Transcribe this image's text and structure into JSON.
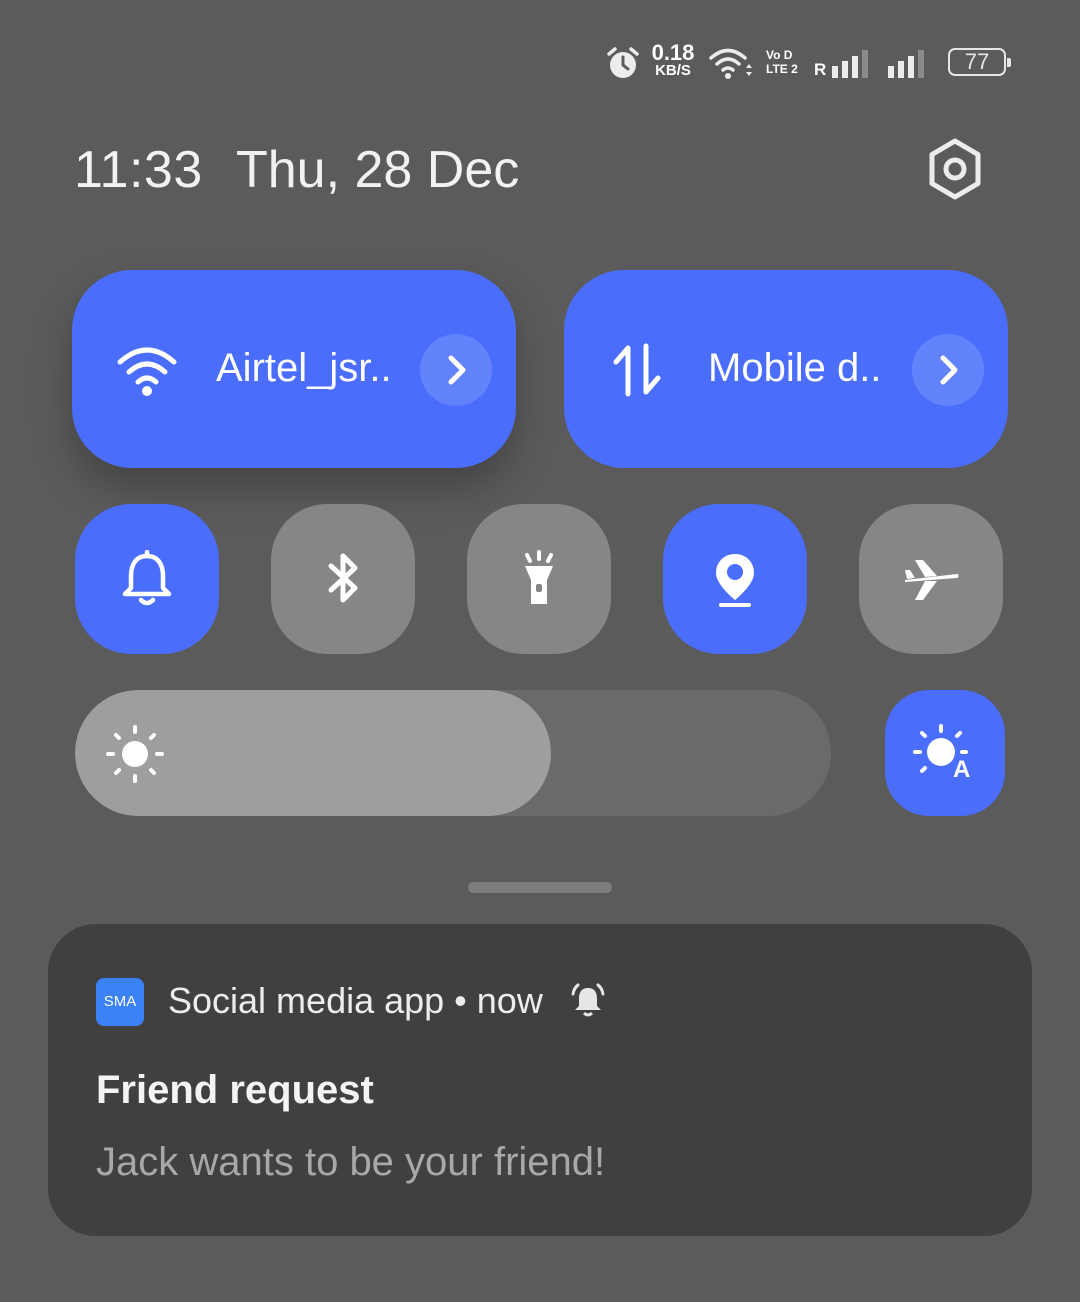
{
  "status_bar": {
    "net_speed_value": "0.18",
    "net_speed_unit": "KB/S",
    "volte_top": "Vo D",
    "volte_bottom": "LTE 2",
    "roaming": "R",
    "battery": "77",
    "icons": [
      "alarm-icon",
      "wifi-icon",
      "signal-icon",
      "signal-icon"
    ]
  },
  "header": {
    "time": "11:33",
    "date": "Thu, 28 Dec",
    "settings_icon": "gear-icon"
  },
  "tiles": {
    "wifi": {
      "label": "Airtel_jsr..",
      "icon": "wifi-icon",
      "active": true
    },
    "mobile_data": {
      "label": "Mobile d..",
      "icon": "data-arrows-icon",
      "active": true
    },
    "quick": [
      {
        "name": "sound",
        "icon": "bell-icon",
        "active": true
      },
      {
        "name": "bluetooth",
        "icon": "bluetooth-icon",
        "active": false
      },
      {
        "name": "flashlight",
        "icon": "flashlight-icon",
        "active": false
      },
      {
        "name": "location",
        "icon": "location-pin-icon",
        "active": true
      },
      {
        "name": "airplane",
        "icon": "airplane-icon",
        "active": false
      }
    ]
  },
  "brightness": {
    "level_fraction": 0.63,
    "auto": true,
    "auto_letter": "A"
  },
  "notification": {
    "app_icon_text": "SMA",
    "app_name": "Social media app",
    "separator": "•",
    "time": "now",
    "title": "Friend request",
    "body": "Jack wants to be your friend!"
  },
  "colors": {
    "accent": "#4a6dfb",
    "tile_off": "#868686",
    "background": "#5b5b5b",
    "notification_bg": "#404040"
  }
}
